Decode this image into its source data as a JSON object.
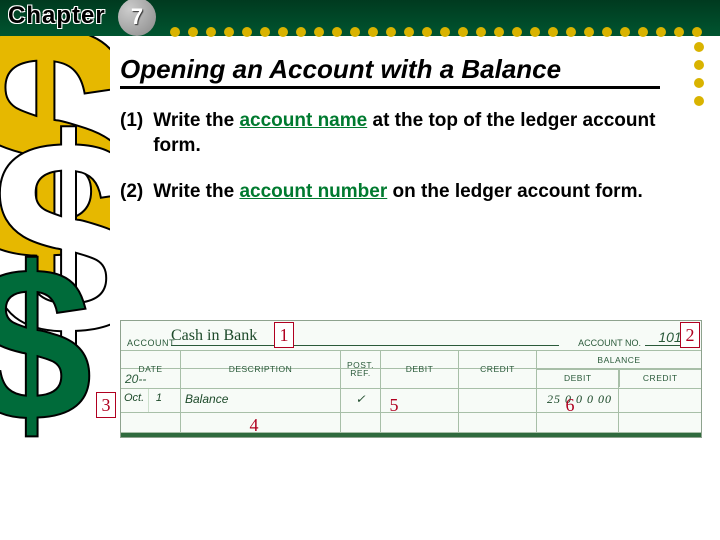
{
  "chapter": {
    "label": "Chapter",
    "number": "7"
  },
  "title": "Opening an Account with a Balance",
  "steps": [
    {
      "num": "(1)",
      "pre": "Write the ",
      "kw": "account name",
      "post": " at the top of the ledger account form."
    },
    {
      "num": "(2)",
      "pre": "Write the ",
      "kw": "account number",
      "post": " on the ledger account form."
    }
  ],
  "callouts": {
    "c1": "1",
    "c2": "2",
    "c3": "3",
    "c4": "4",
    "c5": "5",
    "c6": "6"
  },
  "ledger": {
    "account_label": "ACCOUNT",
    "account_name": "Cash in Bank",
    "account_no_label": "ACCOUNT NO.",
    "account_no": "101",
    "headers": {
      "date": "DATE",
      "description": "DESCRIPTION",
      "post_ref": "POST. REF.",
      "debit": "DEBIT",
      "credit": "CREDIT",
      "balance": "BALANCE",
      "bal_debit": "DEBIT",
      "bal_credit": "CREDIT"
    },
    "year": "20--",
    "entry": {
      "month": "Oct.",
      "day": "1",
      "description": "Balance",
      "post_ref": "✓",
      "bal_debit": "25 0 0 0 00"
    }
  },
  "sidebar_glyph": "$"
}
